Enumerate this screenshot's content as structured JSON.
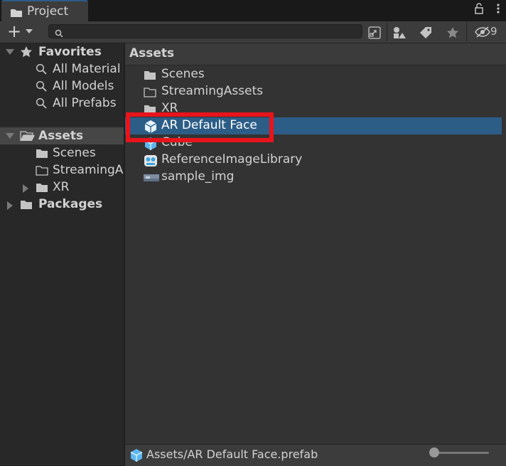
{
  "window": {
    "tab_title": "Project",
    "hidden_count": "9"
  },
  "search": {
    "value": "",
    "placeholder": ""
  },
  "tree": {
    "favorites": {
      "label": "Favorites",
      "items": [
        "All Material",
        "All Models",
        "All Prefabs"
      ]
    },
    "assets": {
      "label": "Assets",
      "children": [
        "Scenes",
        "StreamingA",
        "XR"
      ]
    },
    "packages": {
      "label": "Packages"
    }
  },
  "main": {
    "header": "Assets",
    "items": [
      {
        "label": "Scenes",
        "icon": "folder-icon"
      },
      {
        "label": "StreamingAssets",
        "icon": "folder-outline-icon"
      },
      {
        "label": "XR",
        "icon": "folder-icon"
      },
      {
        "label": "AR Default Face",
        "icon": "prefab-cube-icon",
        "selected": true
      },
      {
        "label": "Cube",
        "icon": "prefab-cube-icon"
      },
      {
        "label": "ReferenceImageLibrary",
        "icon": "image-library-icon"
      },
      {
        "label": "sample_img",
        "icon": "image-thumbnail-icon"
      }
    ]
  },
  "status": {
    "path": "Assets/AR Default Face.prefab",
    "zoom_slider_value": 0.0
  },
  "colors": {
    "selection": "#2c5d87",
    "highlight_box": "#e8141c",
    "panel_bg": "#333333",
    "tree_bg": "#282828"
  }
}
